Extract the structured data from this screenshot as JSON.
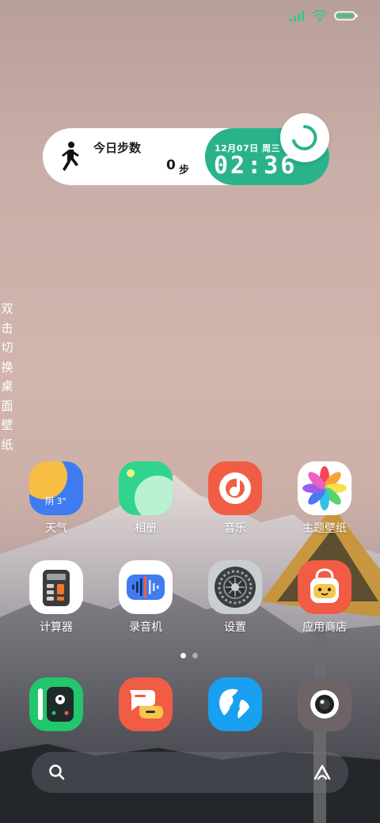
{
  "status_bar": {
    "signal_icon": "signal-icon",
    "wifi_icon": "wifi-icon",
    "battery_icon": "battery-icon"
  },
  "step_widget": {
    "title": "今日步数",
    "count": "0",
    "unit": "步",
    "date": "12月07日 周三",
    "time": "02:36"
  },
  "side_hint": "双击切换桌面壁纸",
  "apps_row1": [
    {
      "label": "天气",
      "icon": "weather-icon",
      "badge": "阴 3°"
    },
    {
      "label": "相册",
      "icon": "gallery-icon"
    },
    {
      "label": "音乐",
      "icon": "music-icon"
    },
    {
      "label": "主题壁纸",
      "icon": "theme-icon"
    }
  ],
  "apps_row2": [
    {
      "label": "计算器",
      "icon": "calculator-icon"
    },
    {
      "label": "录音机",
      "icon": "recorder-icon"
    },
    {
      "label": "设置",
      "icon": "settings-icon"
    },
    {
      "label": "应用商店",
      "icon": "app-store-icon"
    }
  ],
  "page_indicator": {
    "pages": 2,
    "current": 1
  },
  "dock": [
    {
      "icon": "phone-icon"
    },
    {
      "icon": "messages-icon"
    },
    {
      "icon": "browser-icon"
    },
    {
      "icon": "camera-icon"
    }
  ],
  "search_bar": {
    "search_icon": "search-icon",
    "assistant_icon": "assistant-icon"
  },
  "colors": {
    "widget_green": "#2ab38a",
    "weather_blue": "#3f7bf1",
    "music_red": "#f15c45",
    "dock_green": "#22c76b"
  }
}
